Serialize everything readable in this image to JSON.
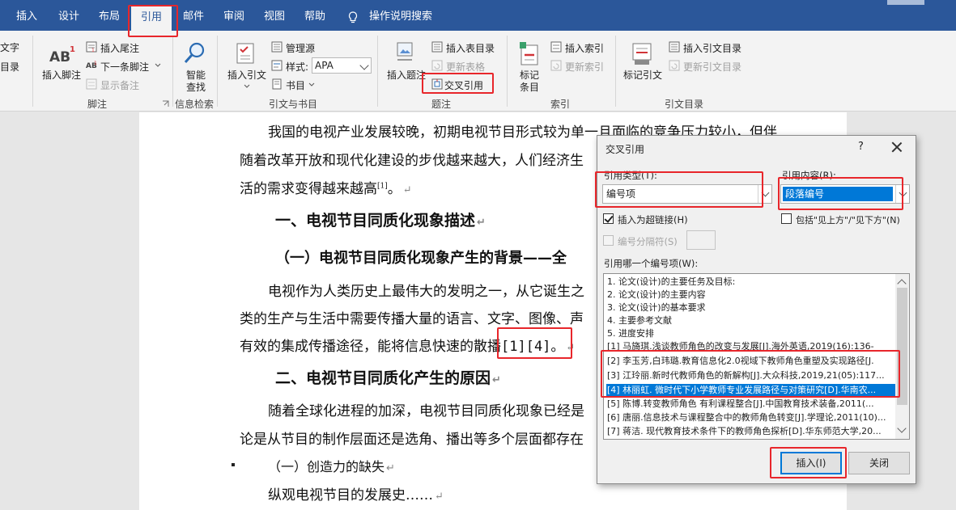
{
  "tabs": [
    {
      "label": "插入"
    },
    {
      "label": "设计"
    },
    {
      "label": "布局"
    },
    {
      "label": "引用"
    },
    {
      "label": "邮件"
    },
    {
      "label": "审阅"
    },
    {
      "label": "视图"
    },
    {
      "label": "帮助"
    },
    {
      "label": "操作说明搜索"
    }
  ],
  "ribbon": {
    "toc_partial_1": "文字",
    "toc_partial_2": "目录",
    "insert_footnote": "插入脚注",
    "insert_endnote": "插入尾注",
    "next_footnote": "下一条脚注",
    "show_notes": "显示备注",
    "group_footnote": "脚注",
    "smart_lookup_1": "智能",
    "smart_lookup_2": "查找",
    "group_research": "信息检索",
    "insert_citation": "插入引文",
    "manage_sources": "管理源",
    "style_label": "样式:",
    "style_value": "APA",
    "bibliography": "书目",
    "group_citations": "引文与书目",
    "insert_caption": "插入题注",
    "insert_table_of_figures": "插入表目录",
    "update_table": "更新表格",
    "cross_reference": "交叉引用",
    "group_captions": "题注",
    "mark_entry_1": "标记",
    "mark_entry_2": "条目",
    "insert_index": "插入索引",
    "update_index": "更新索引",
    "group_index": "索引",
    "mark_citation": "标记引文",
    "insert_toa": "插入引文目录",
    "update_toa": "更新引文目录",
    "group_toa": "引文目录"
  },
  "document": {
    "p1_line1": "我国的电视产业发展较晚，初期电视节目形式较为单一且面临的竞争压力较小，但伴",
    "p1_line2": "随着改革开放和现代化建设的步伐越来越大，人们经济生",
    "p1_line3": "活的需求变得越来越高",
    "p1_ref": "[1]",
    "p1_end": "。",
    "h1": "一、电视节目同质化现象描述",
    "h1_sub": "（一）电视节目同质化现象产生的背景——全",
    "p2_line1": "电视作为人类历史上最伟大的发明之一，从它诞生之",
    "p2_line2": "类的生产与生活中需要传播大量的语言、文字、图像、声",
    "p2_line3_a": "有效的集成传播途径，能将信息快速的散",
    "p2_line3_b": "播[1][4]。",
    "h2": "二、电视节目同质化产生的原因",
    "p3_line1": "随着全球化进程的加深，电视节目同质化现象已经是",
    "p3_line2": "论是从节目的制作层面还是选角、播出等多个层面都存在",
    "bullet_item": "（一）创造力的缺失",
    "p4": "纵观电视节目的发展史……"
  },
  "dialog": {
    "title": "交叉引用",
    "help": "?",
    "ref_type_label": "引用类型(T):",
    "ref_type_value": "编号项",
    "ref_content_label": "引用内容(R):",
    "ref_content_value": "段落编号",
    "insert_hyperlink": "插入为超链接(H)",
    "include_above_below": "包括\"见上方\"/\"见下方\"(N)",
    "separate_numbers": "编号分隔符(S)",
    "which_item_label": "引用哪一个编号项(W):",
    "items": [
      "1. 论文(设计)的主要任务及目标:",
      "2. 论文(设计)的主要内容",
      "3. 论文(设计)的基本要求",
      "4. 主要参考文献",
      "5. 进度安排",
      "[1] 马旖琪.浅谈教师角色的改变与发展[J].海外英语,2019(16):136-",
      "[2] 李玉芳,白玮璐.教育信息化2.0视域下教师角色重塑及实现路径[J.",
      "[3] 江玲丽.新时代教师角色的新解构[J].大众科技,2019,21(05):117...",
      "[4] 林丽虹. 微时代下小学教师专业发展路径与对策研究[D].华南农...",
      "[5] 陈博.转变教师角色   有利课程整合[J].中国教育技术装备,2011(...",
      "[6] 唐丽.信息技术与课程整合中的教师角色转变[J].学理论,2011(10)...",
      "[7] 蒋洁. 现代教育技术条件下的教师角色探析[D].华东师范大学,20..."
    ],
    "insert_button": "插入(I)",
    "close_button": "关闭"
  }
}
